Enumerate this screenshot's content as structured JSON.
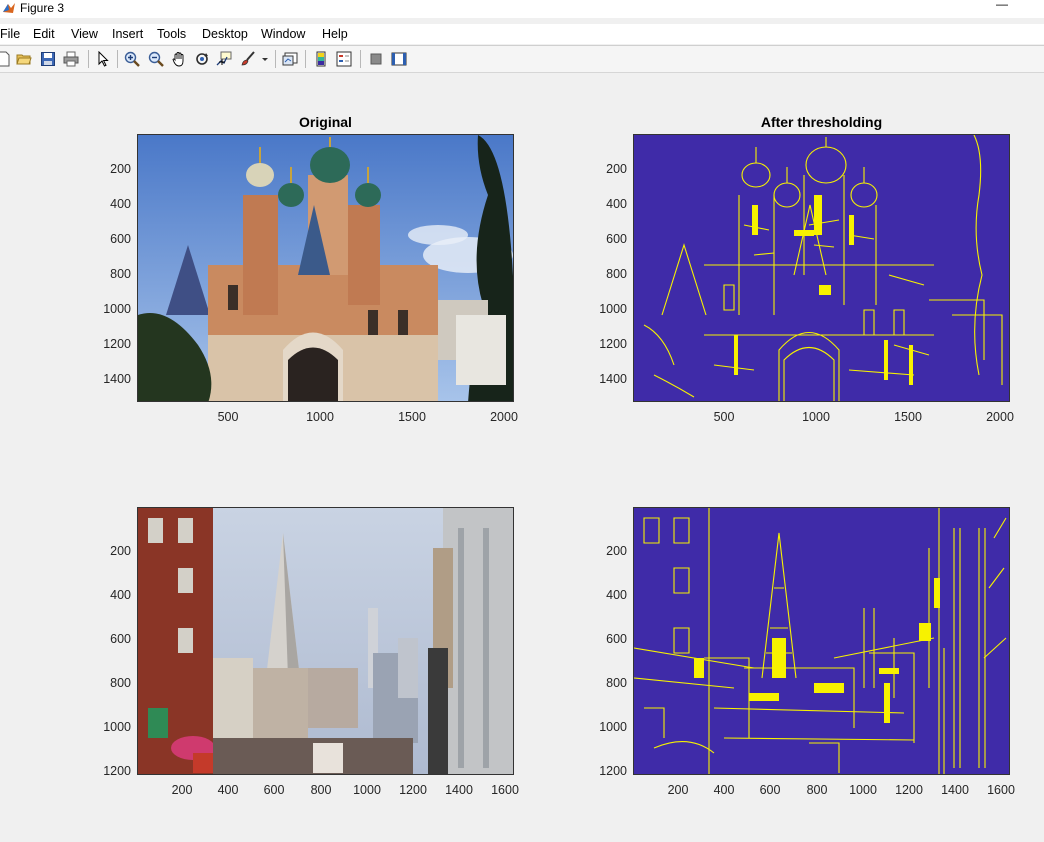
{
  "window": {
    "title": "Figure 3",
    "minimize_glyph": "—"
  },
  "menu": [
    "File",
    "Edit",
    "View",
    "Insert",
    "Tools",
    "Desktop",
    "Window",
    "Help"
  ],
  "toolbar": {
    "icons": [
      "new-file-icon",
      "open-folder-icon",
      "save-icon",
      "print-icon",
      "pointer-icon",
      "zoom-in-icon",
      "zoom-out-icon",
      "pan-hand-icon",
      "rotate-3d-icon",
      "data-cursor-icon",
      "brush-icon",
      "brush-dropdown-icon",
      "link-plot-icon",
      "colorbar-icon",
      "legend-icon",
      "hide-plot-tools-icon",
      "show-plot-tools-icon"
    ]
  },
  "colors": {
    "threshold_bg": "#3f2ba8",
    "threshold_fg": "#f7f200",
    "figure_bg": "#f0f0f0"
  },
  "subplots": [
    {
      "title": "Original",
      "image": "cathedral-photo",
      "yticks": [
        "200",
        "400",
        "600",
        "800",
        "1000",
        "1200",
        "1400"
      ],
      "xticks": [
        "500",
        "1000",
        "1500",
        "2000"
      ]
    },
    {
      "title": "After thresholding",
      "image": "cathedral-threshold",
      "yticks": [
        "200",
        "400",
        "600",
        "800",
        "1000",
        "1200",
        "1400"
      ],
      "xticks": [
        "500",
        "1000",
        "1500",
        "2000"
      ]
    },
    {
      "title": "",
      "image": "city-street-photo",
      "yticks": [
        "200",
        "400",
        "600",
        "800",
        "1000",
        "1200"
      ],
      "xticks": [
        "200",
        "400",
        "600",
        "800",
        "1000",
        "1200",
        "1400",
        "1600"
      ]
    },
    {
      "title": "",
      "image": "city-street-threshold",
      "yticks": [
        "200",
        "400",
        "600",
        "800",
        "1000",
        "1200"
      ],
      "xticks": [
        "200",
        "400",
        "600",
        "800",
        "1000",
        "1200",
        "1400",
        "1600"
      ]
    }
  ]
}
